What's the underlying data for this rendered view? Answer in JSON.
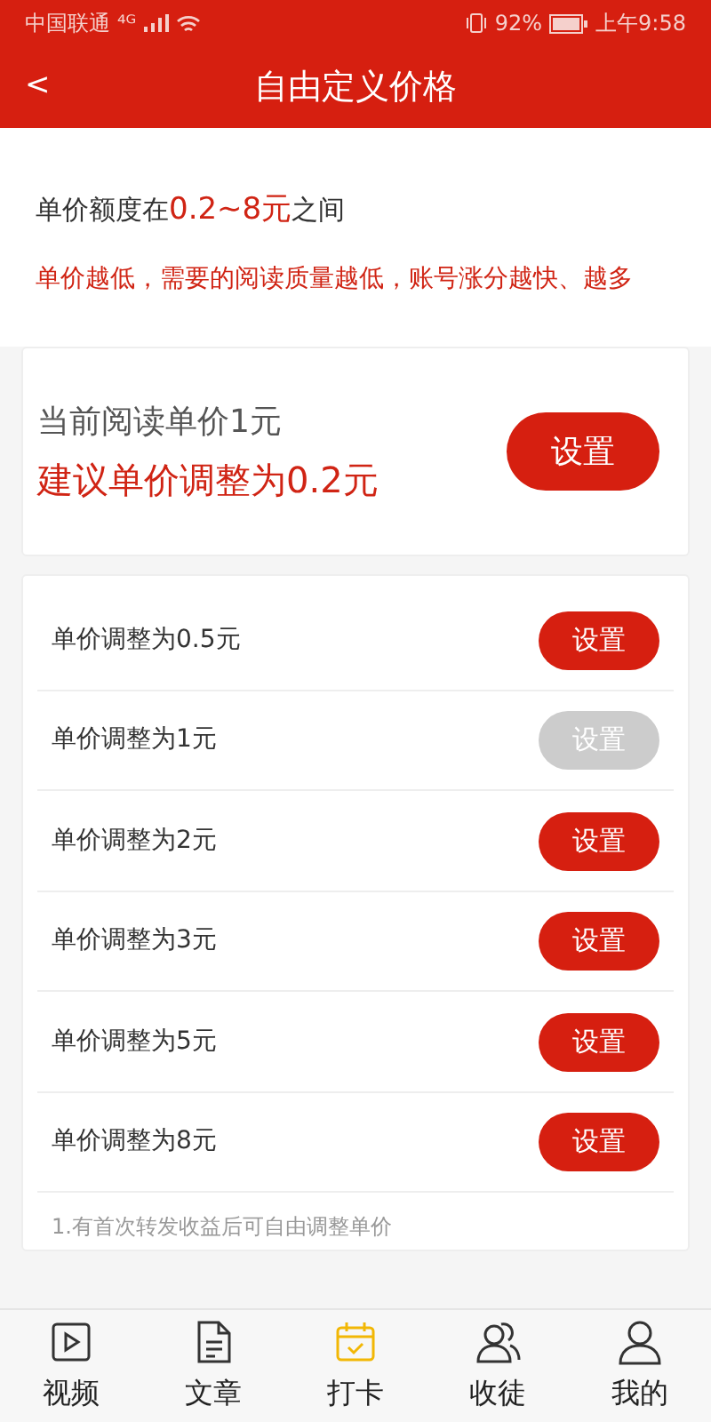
{
  "status_bar": {
    "carrier": "中国联通",
    "signal": "⁴ᴳ",
    "battery": "92%",
    "time": "上午9:58"
  },
  "header": {
    "back": "<",
    "title": "自由定义价格"
  },
  "range_note": "单价额度在**0.2~8元**之间",
  "warning": "单价越低，需要的阅读质量越低，账号涨分越快、越多",
  "current": {
    "label": "当前阅读单价1元",
    "suggestion": "建议单价调整为0.2元",
    "button": "设置"
  },
  "options": [
    {
      "label": "单价调整为0.5元",
      "button": "设置",
      "disabled": false
    },
    {
      "label": "单价调整为1元",
      "button": "设置",
      "disabled": true
    },
    {
      "label": "单价调整为2元",
      "button": "设置",
      "disabled": false
    },
    {
      "label": "单价调整为3元",
      "button": "设置",
      "disabled": false
    },
    {
      "label": "单价调整为5元",
      "button": "设置",
      "disabled": false
    },
    {
      "label": "单价调整为8元",
      "button": "设置",
      "disabled": false
    }
  ],
  "footnote": "1.有首次转发收益后可自由调整单价",
  "tabs": [
    {
      "kind": "video",
      "label": "视频",
      "color": "#333333"
    },
    {
      "kind": "article",
      "label": "文章",
      "color": "#333333"
    },
    {
      "kind": "checkin",
      "label": "打卡",
      "color": "#f2b705"
    },
    {
      "kind": "disciples",
      "label": "收徒",
      "color": "#333333"
    },
    {
      "kind": "me",
      "label": "我的",
      "color": "#333333"
    }
  ]
}
